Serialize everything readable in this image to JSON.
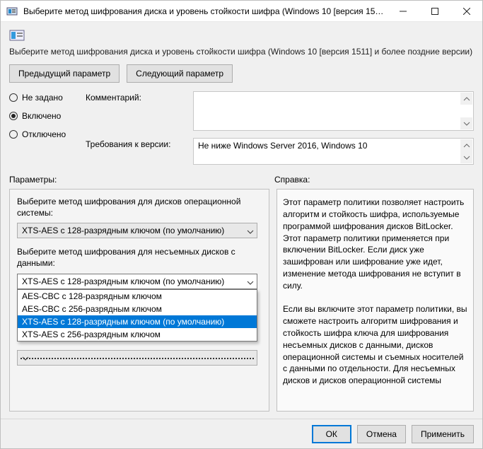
{
  "window": {
    "title": "Выберите метод шифрования диска и уровень стойкости шифра (Windows 10 [версия 1511]..."
  },
  "header": {
    "policy_desc": "Выберите метод шифрования диска и уровень стойкости шифра (Windows 10 [версия 1511] и более поздние версии)"
  },
  "nav": {
    "prev": "Предыдущий параметр",
    "next": "Следующий параметр"
  },
  "state": {
    "not_configured": "Не задано",
    "enabled": "Включено",
    "disabled": "Отключено",
    "selected": "enabled"
  },
  "fields": {
    "comment_label": "Комментарий:",
    "comment_value": "",
    "requirements_label": "Требования к версии:",
    "requirements_value": "Не ниже Windows Server 2016, Windows 10"
  },
  "panes": {
    "params_label": "Параметры:",
    "help_label": "Справка:"
  },
  "params": {
    "os_drive_label": "Выберите метод шифрования для дисков операционной системы:",
    "os_drive_value": "XTS-AES с 128-разрядным ключом (по умолчанию)",
    "fixed_drive_label": "Выберите метод шифрования для несъемных дисков с данными:",
    "fixed_drive_value": "XTS-AES с 128-разрядным ключом (по умолчанию)",
    "dropdown_options": [
      "AES-CBC с 128-разрядным ключом",
      "AES-CBC с 256-разрядным ключом",
      "XTS-AES с 128-разрядным ключом (по умолчанию)",
      "XTS-AES с 256-разрядным ключом"
    ],
    "dropdown_highlight_index": 2
  },
  "help": {
    "text": "Этот параметр политики позволяет настроить алгоритм и стойкость шифра, используемые программой шифрования дисков BitLocker. Этот параметр политики применяется при включении BitLocker. Если диск уже зашифрован или шифрование уже идет, изменение метода шифрования не вступит в силу.\n\nЕсли вы включите этот параметр политики, вы сможете настроить алгоритм шифрования и стойкость шифра ключа для шифрования несъемных дисков с данными, дисков операционной системы и съемных носителей с данными по отдельности. Для несъемных дисков и дисков операционной системы"
  },
  "footer": {
    "ok": "ОК",
    "cancel": "Отмена",
    "apply": "Применить"
  }
}
